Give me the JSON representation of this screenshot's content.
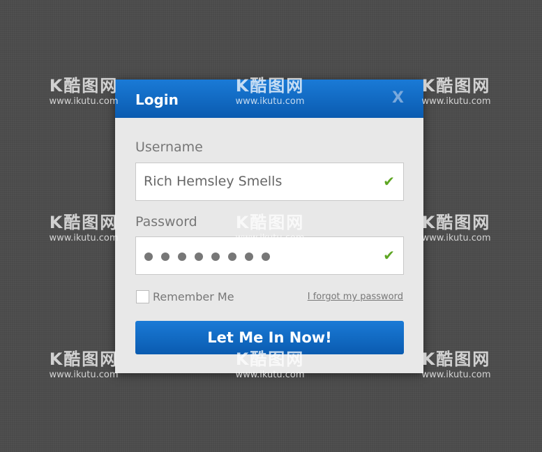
{
  "dialog": {
    "title": "Login",
    "close_label": "X",
    "username": {
      "label": "Username",
      "value": "Rich Hemsley Smells",
      "valid_icon": "checkmark-icon"
    },
    "password": {
      "label": "Password",
      "masked_length": 8,
      "valid_icon": "checkmark-icon"
    },
    "remember_label": "Remember Me",
    "remember_checked": false,
    "forgot_link": "I forgot my password",
    "submit_label": "Let Me In Now!"
  },
  "colors": {
    "accent": "#0a6ac6",
    "check": "#5ea623",
    "background": "#4a4a4a"
  },
  "watermark": {
    "logo": "K酷图网",
    "url": "www.ikutu.com"
  }
}
